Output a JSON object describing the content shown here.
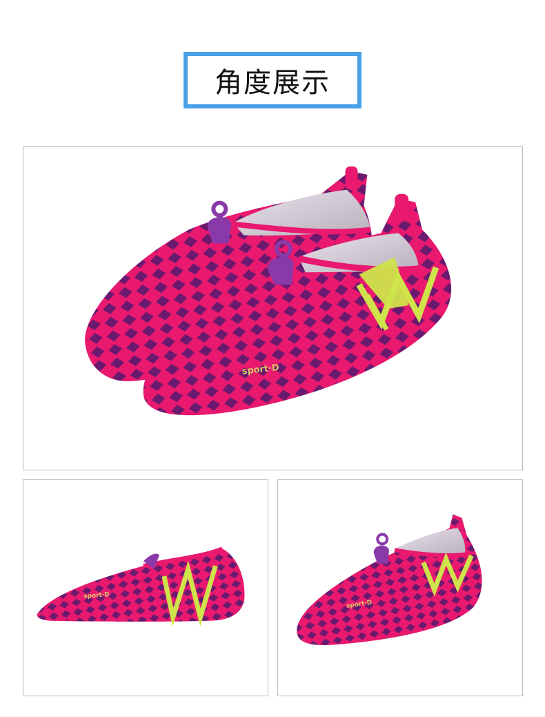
{
  "header": {
    "title": "角度展示"
  },
  "colors": {
    "title_border": "#4aa0e6",
    "shoe_pink": "#e8196e",
    "shoe_purple": "#6a1a6e",
    "stripe_green": "#cfe34a",
    "frame_border": "#b9b9b9"
  },
  "photos": {
    "main": {
      "brand_text": "sport·D"
    },
    "side": {
      "brand_text": "sport·D"
    },
    "angle": {
      "brand_text": "sport·D"
    }
  }
}
